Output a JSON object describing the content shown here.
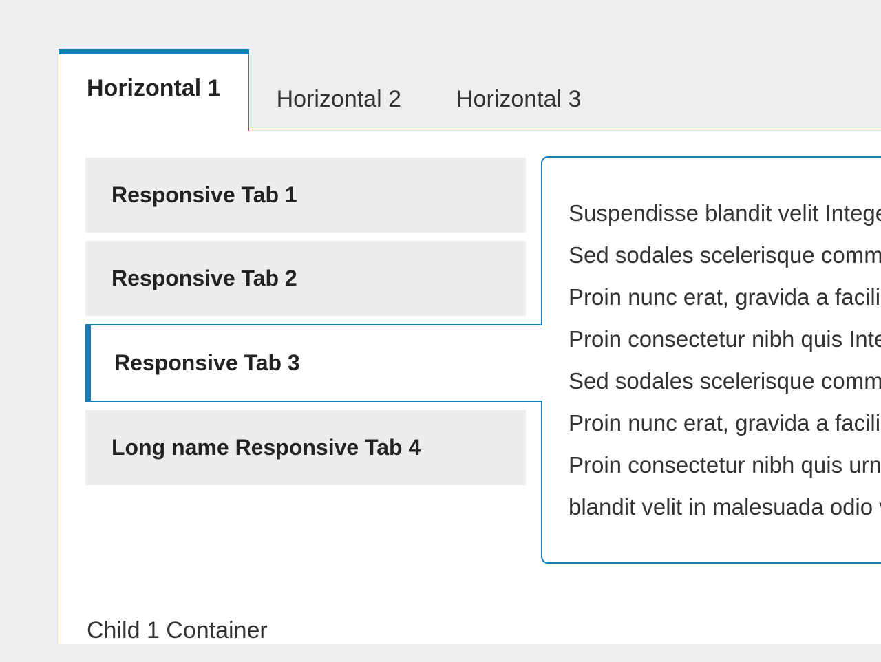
{
  "colors": {
    "accent": "#1a7bb9",
    "page_bg": "#eeeeee",
    "tab_inactive_bg": "#ededed"
  },
  "horizontal_tabs": {
    "active_index": 0,
    "items": [
      {
        "label": "Horizontal 1"
      },
      {
        "label": "Horizontal 2"
      },
      {
        "label": "Horizontal 3"
      }
    ]
  },
  "vertical_tabs": {
    "active_index": 2,
    "items": [
      {
        "label": "Responsive Tab 1"
      },
      {
        "label": "Responsive Tab 2"
      },
      {
        "label": "Responsive Tab 3"
      },
      {
        "label": "Long name Responsive Tab 4"
      }
    ]
  },
  "content": {
    "paragraph": "Suspendisse blandit velit Integer laoreet placerat suscipit. Sed sodales scelerisque commodo. Nam porta cursus lectus. Proin nunc erat, gravida a facilisis quis, ornare id lectus. Proin consectetur nibh quis Integer laoreet placerat suscipit. Sed sodales scelerisque commodo. Nam porta cursus lectus. Proin nunc erat, gravida a facilisis quis, ornare id lectus. Proin consectetur nibh quis urna gravida mollis. Suspendisse blandit velit in malesuada odio venenatis."
  },
  "caption": "Child 1 Container"
}
